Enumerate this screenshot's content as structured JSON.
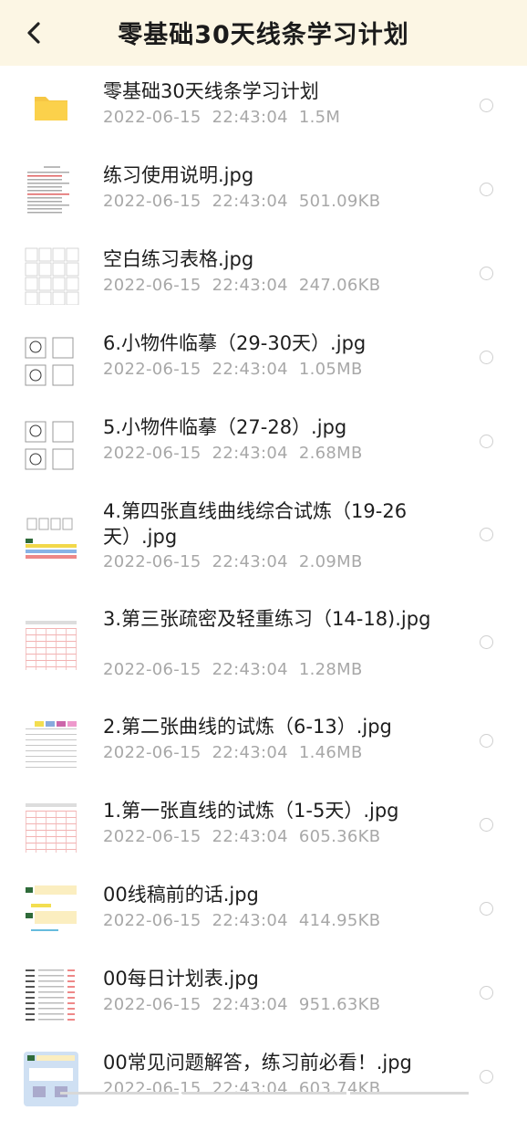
{
  "header": {
    "title": "零基础30天线条学习计划",
    "back_icon": "chevron-left-icon"
  },
  "files": [
    {
      "name": "零基础30天线条学习计划",
      "date": "2022-06-15",
      "time": "22:43:04",
      "size": "1.5M",
      "thumb": "folder"
    },
    {
      "name": "练习使用说明.jpg",
      "date": "2022-06-15",
      "time": "22:43:04",
      "size": "501.09KB",
      "thumb": "doc"
    },
    {
      "name": "空白练习表格.jpg",
      "date": "2022-06-15",
      "time": "22:43:04",
      "size": "247.06KB",
      "thumb": "grid"
    },
    {
      "name": "6.小物件临摹（29-30天）.jpg",
      "date": "2022-06-15",
      "time": "22:43:04",
      "size": "1.05MB",
      "thumb": "sketch"
    },
    {
      "name": "5.小物件临摹（27-28）.jpg",
      "date": "2022-06-15",
      "time": "22:43:04",
      "size": "2.68MB",
      "thumb": "sketch"
    },
    {
      "name": "4.第四张直线曲线综合试炼（19-26天）.jpg",
      "date": "2022-06-15",
      "time": "22:43:04",
      "size": "2.09MB",
      "thumb": "colorful"
    },
    {
      "name": "3.第三张疏密及轻重练习（14-18).jpg",
      "date": "2022-06-15",
      "time": "22:43:04",
      "size": "1.28MB",
      "thumb": "pinktable"
    },
    {
      "name": "2.第二张曲线的试炼（6-13）.jpg",
      "date": "2022-06-15",
      "time": "22:43:04",
      "size": "1.46MB",
      "thumb": "coloredtable"
    },
    {
      "name": "1.第一张直线的试炼（1-5天）.jpg",
      "date": "2022-06-15",
      "time": "22:43:04",
      "size": "605.36KB",
      "thumb": "pinktable"
    },
    {
      "name": "00线稿前的话.jpg",
      "date": "2022-06-15",
      "time": "22:43:04",
      "size": "414.95KB",
      "thumb": "chat"
    },
    {
      "name": "00每日计划表.jpg",
      "date": "2022-06-15",
      "time": "22:43:04",
      "size": "951.63KB",
      "thumb": "list"
    },
    {
      "name": "00常见问题解答，练习前必看！.jpg",
      "date": "2022-06-15",
      "time": "22:43:04",
      "size": "603.74KB",
      "thumb": "blue"
    }
  ]
}
